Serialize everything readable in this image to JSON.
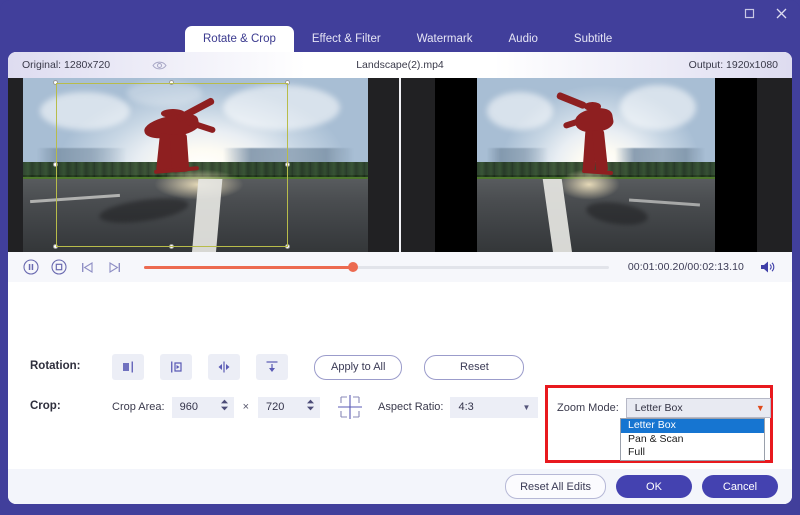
{
  "window": {
    "maximize_icon": "maximize-icon",
    "close_icon": "close-icon"
  },
  "tabs": [
    {
      "label": "Rotate & Crop",
      "active": true
    },
    {
      "label": "Effect & Filter",
      "active": false
    },
    {
      "label": "Watermark",
      "active": false
    },
    {
      "label": "Audio",
      "active": false
    },
    {
      "label": "Subtitle",
      "active": false
    }
  ],
  "infobar": {
    "original": "Original: 1280x720",
    "preview_icon": "eye-icon",
    "filename": "Landscape(2).mp4",
    "output": "Output: 1920x1080"
  },
  "transport": {
    "pause_icon": "pause-icon",
    "stop_icon": "stop-icon",
    "prev_frame_icon": "previous-frame-icon",
    "next_frame_icon": "next-frame-icon",
    "progress_percent": 45,
    "timecode": "00:01:00.20/00:02:13.10",
    "volume_icon": "volume-icon"
  },
  "rotation": {
    "label": "Rotation:",
    "buttons": [
      {
        "name": "rotate-left-button",
        "icon": "rotate-left-icon"
      },
      {
        "name": "rotate-right-button",
        "icon": "rotate-right-icon"
      },
      {
        "name": "flip-horizontal-button",
        "icon": "flip-horizontal-icon"
      },
      {
        "name": "flip-vertical-button",
        "icon": "flip-vertical-icon"
      }
    ],
    "apply_to_all": "Apply to All",
    "reset": "Reset"
  },
  "crop": {
    "label": "Crop:",
    "area_label": "Crop Area:",
    "width": "960",
    "height": "720",
    "times_symbol": "×",
    "center_icon": "center-crop-icon",
    "aspect_label": "Aspect Ratio:",
    "aspect_value": "4:3",
    "aspect_caret": "▼"
  },
  "zoom_mode": {
    "label": "Zoom Mode:",
    "selected": "Letter Box",
    "caret": "▼",
    "options": [
      {
        "label": "Letter Box",
        "selected": true
      },
      {
        "label": "Pan & Scan",
        "selected": false
      },
      {
        "label": "Full",
        "selected": false
      }
    ],
    "highlight_color": "#e8191e"
  },
  "footer": {
    "reset_all": "Reset All Edits",
    "ok": "OK",
    "cancel": "Cancel"
  },
  "theme": {
    "brand_purple": "#413f9b",
    "accent_orange": "#ec6a50",
    "crop_border": "#b8bc4a",
    "dropdown_highlight": "#1675d1"
  }
}
